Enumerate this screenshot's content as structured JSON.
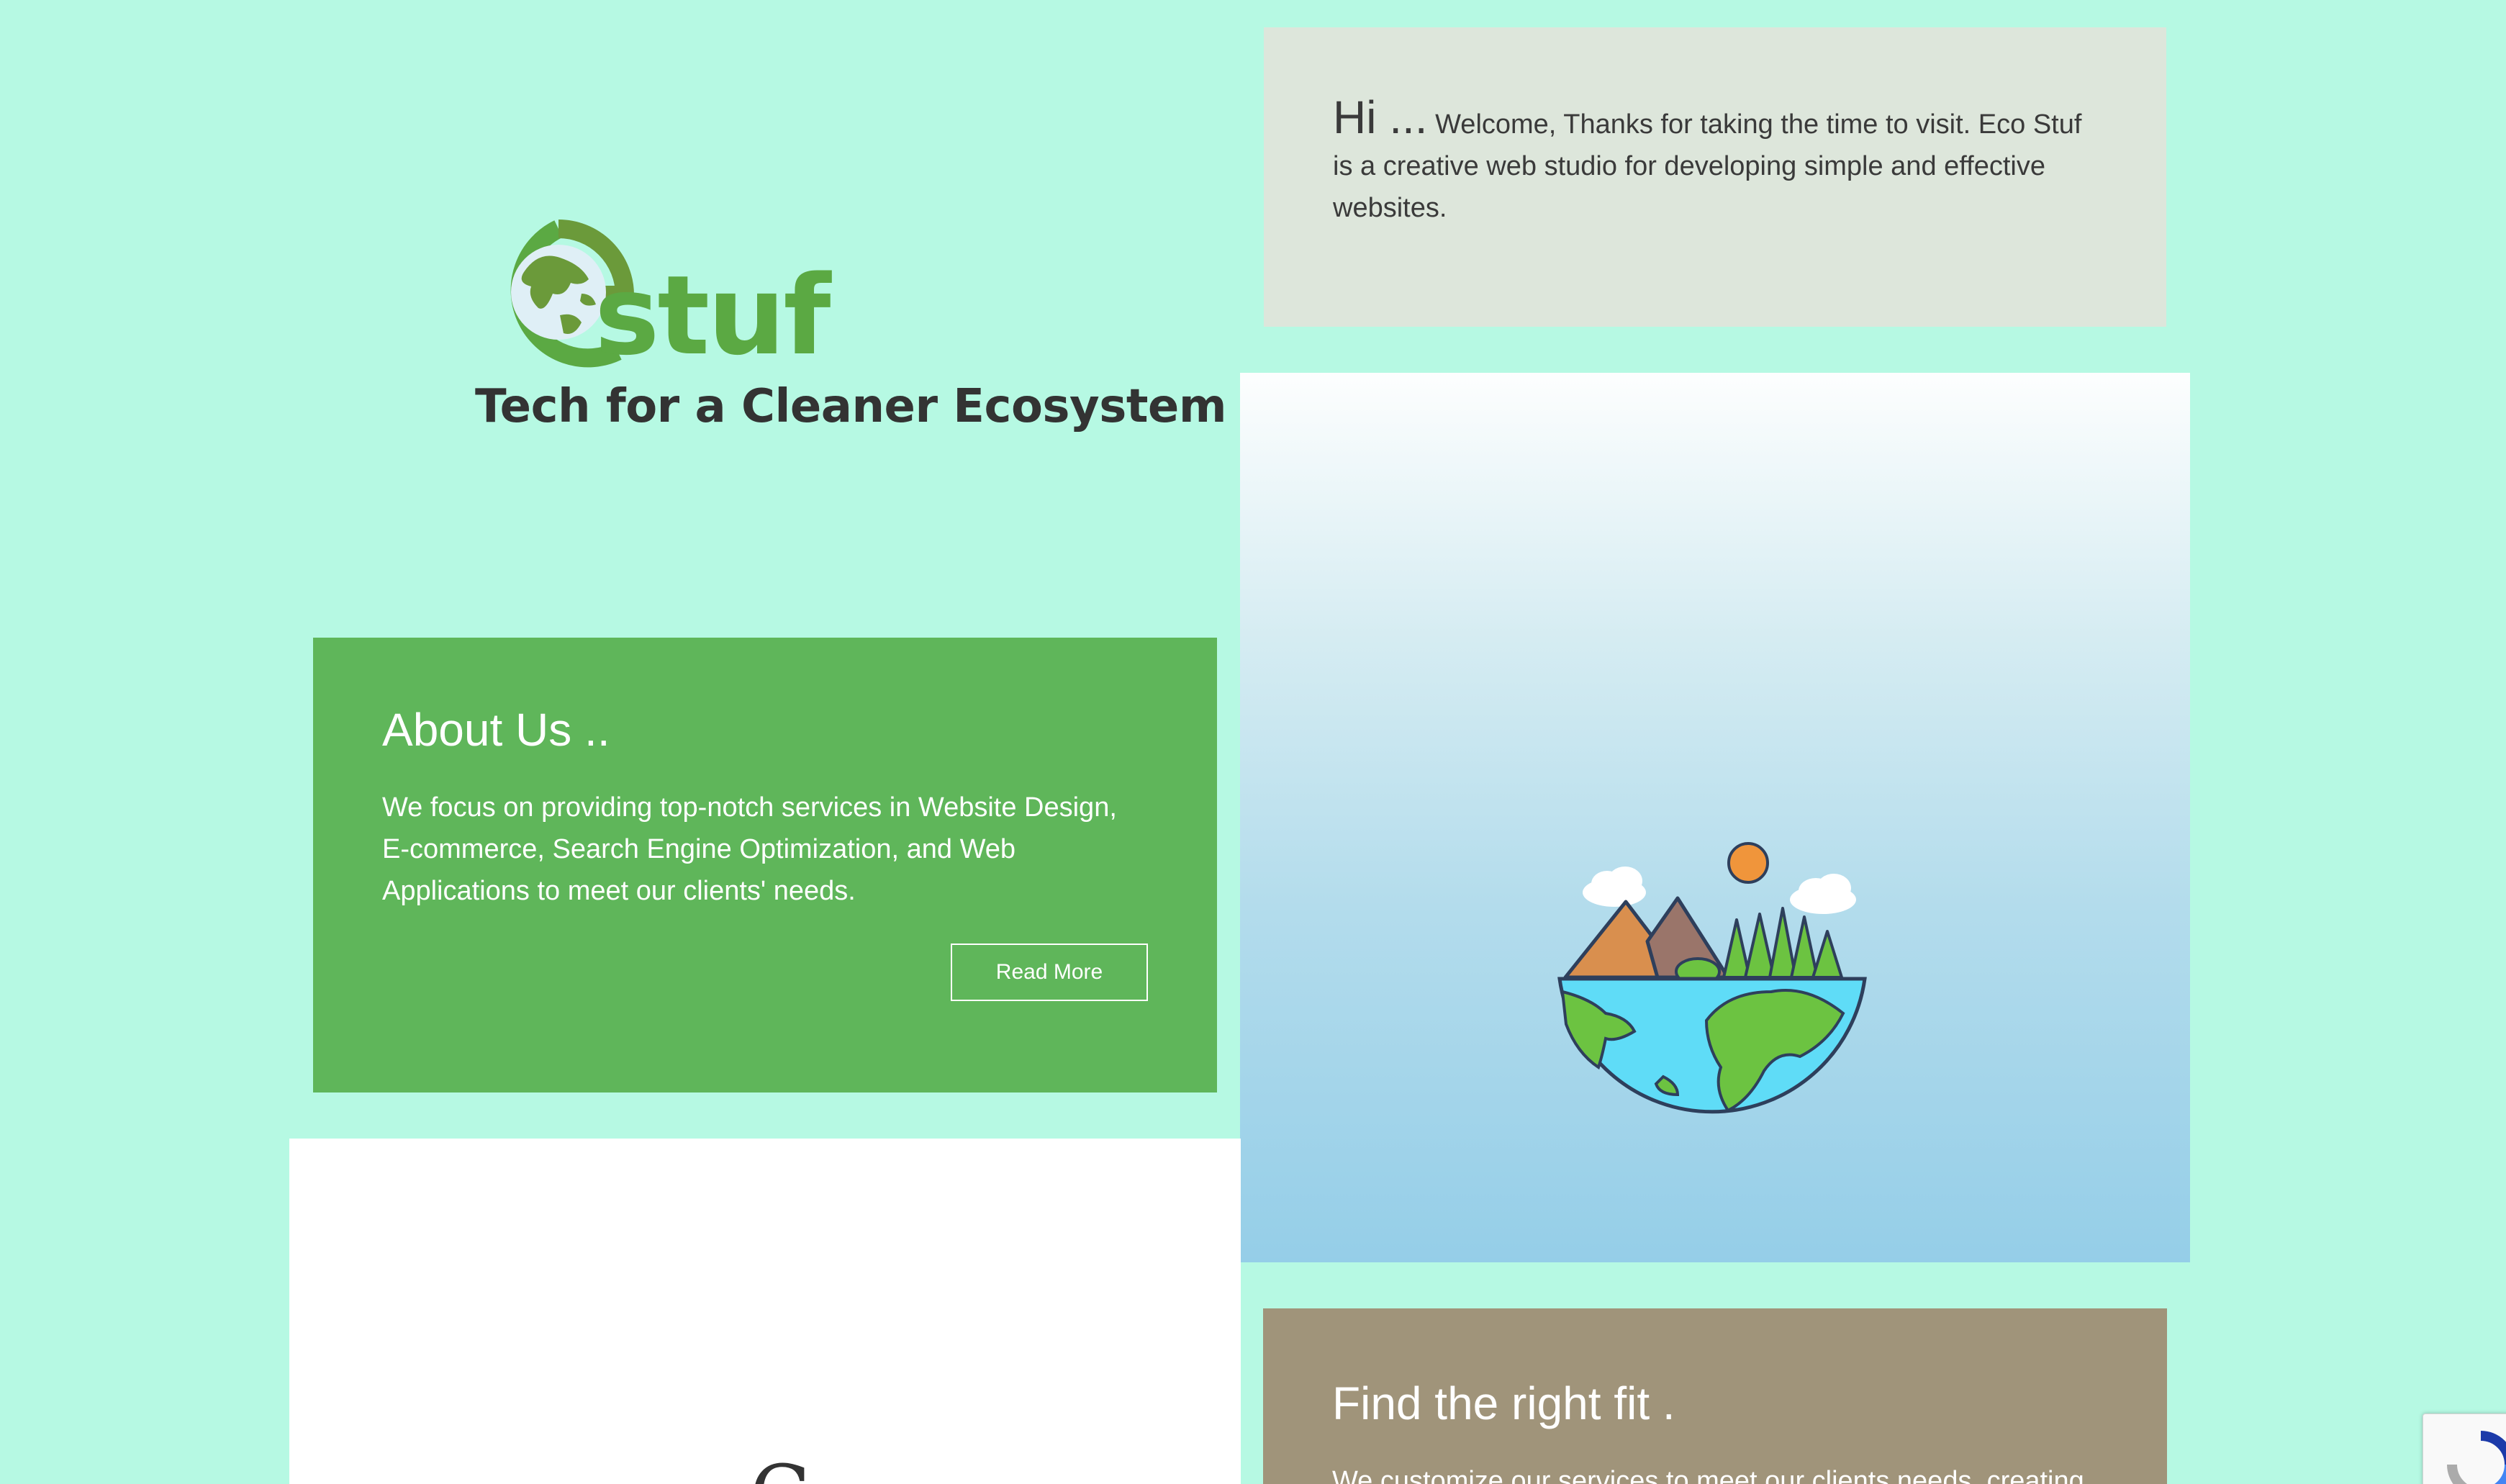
{
  "logo": {
    "wordmark": "stuf",
    "tagline": "Tech for a Cleaner Ecosystem"
  },
  "welcome": {
    "greeting": "Hi ...",
    "text": "Welcome, Thanks for taking the time to visit. Eco Stuf is a creative web studio for developing simple and effective websites."
  },
  "about": {
    "title": "About Us ..",
    "text": "We focus on providing top-notch services in Website Design, E-commerce, Search Engine Optimization, and Web Applications to meet our clients' needs.",
    "button_label": "Read More"
  },
  "fit": {
    "title": "Find the right fit .",
    "text": "We customize our services to meet our clients needs, creating"
  },
  "white_panel": {
    "partial_glyph": "C"
  },
  "colors": {
    "background": "#b6f9e3",
    "welcome_card": "#dde6db",
    "about_card": "#5fb65a",
    "fit_card": "#a0947a",
    "brand_green": "#5ba943"
  },
  "icons": {
    "logo": "globe-e-logo-icon",
    "illustration": "earth-landscape-icon",
    "recaptcha": "recaptcha-icon"
  }
}
